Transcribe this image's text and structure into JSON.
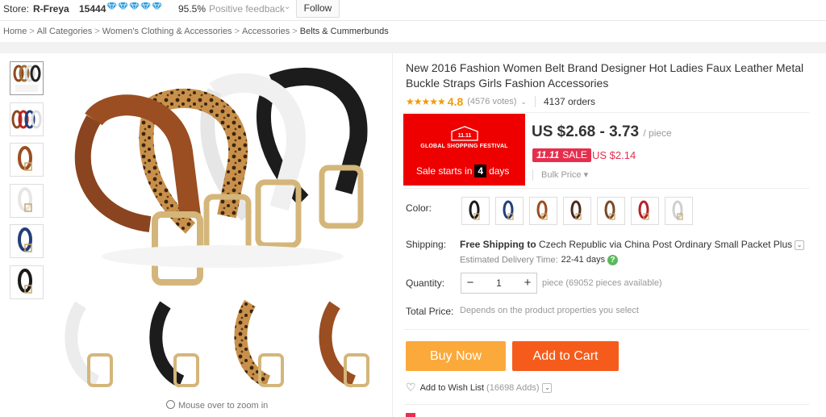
{
  "store_bar": {
    "store_label": "Store:",
    "store_name": "R-Freya",
    "score": "15444",
    "feedback_percent": "95.5%",
    "feedback_label": "Positive feedback",
    "follow_label": "Follow",
    "diamond_color": "#2d9cdb"
  },
  "breadcrumb": {
    "items": [
      "Home",
      "All Categories",
      "Women's Clothing & Accessories",
      "Accessories",
      "Belts & Cummerbunds"
    ],
    "separator": ">"
  },
  "gallery": {
    "zoom_hint": "Mouse over to zoom in"
  },
  "product": {
    "title": "New 2016 Fashion Women Belt Brand Designer Hot Ladies Faux Leather Metal Buckle Straps Girls Fashion Accessories",
    "rating": "4.8",
    "votes": "(4576 votes)",
    "orders": "4137 orders",
    "festival_text": "GLOBAL SHOPPING FESTIVAL",
    "festival_logo_text": "11.11",
    "sale_starts_prefix": "Sale starts in",
    "sale_days": "4",
    "sale_days_suffix": "days",
    "price": "US $2.68 - 3.73",
    "per_unit": "/ piece",
    "sale_tag_event": "11.11",
    "sale_tag_label": "SALE",
    "sale_price": "US $2.14",
    "bulk_price_label": "Bulk Price",
    "color_label": "Color:",
    "shipping_label": "Shipping:",
    "shipping_free": "Free Shipping to",
    "shipping_dest": "Czech Republic via China Post Ordinary Small Packet Plus",
    "delivery_label": "Estimated Delivery Time:",
    "delivery_days": "22-41 days",
    "quantity_label": "Quantity:",
    "quantity_value": "1",
    "availability": "piece (69052 pieces available)",
    "total_label": "Total Price:",
    "total_hint": "Depends on the product properties you select",
    "buy_now_label": "Buy Now",
    "add_to_cart_label": "Add to Cart",
    "wishlist_label": "Add to Wish List",
    "wishlist_count": "(16698 Adds)",
    "accent_color": "#e62e4d",
    "buy_now_color": "#fba93b",
    "add_to_cart_color": "#f55c1c",
    "festival_bg_color": "#ee0000"
  }
}
